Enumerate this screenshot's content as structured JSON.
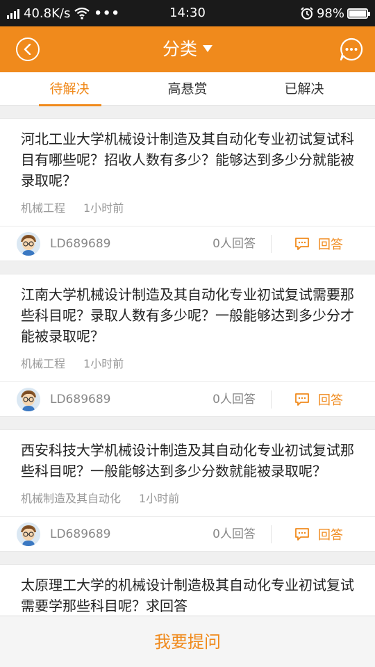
{
  "status_bar": {
    "speed": "40.8K/s",
    "dots": "•••",
    "time": "14:30",
    "battery": "98%",
    "battery_level": 0.98
  },
  "header": {
    "title": "分类"
  },
  "tabs": [
    {
      "label": "待解决"
    },
    {
      "label": "高悬赏"
    },
    {
      "label": "已解决"
    }
  ],
  "questions": [
    {
      "title": "河北工业大学机械设计制造及其自动化专业初试复试科目有哪些呢？招收人数有多少？能够达到多少分就能被录取呢？",
      "category": "机械工程",
      "time": "1小时前",
      "user": "LD689689",
      "answers": "0人回答",
      "answer_label": "回答"
    },
    {
      "title": "江南大学机械设计制造及其自动化专业初试复试需要那些科目呢？录取人数有多少呢？一般能够达到多少分才能被录取呢？",
      "category": "机械工程",
      "time": "1小时前",
      "user": "LD689689",
      "answers": "0人回答",
      "answer_label": "回答"
    },
    {
      "title": "西安科技大学机械设计制造及其自动化专业初试复试那些科目呢？一般能够达到多少分数就能被录取呢？",
      "category": "机械制造及其自动化",
      "time": "1小时前",
      "user": "LD689689",
      "answers": "0人回答",
      "answer_label": "回答"
    },
    {
      "title": "太原理工大学的机械设计制造极其自动化专业初试复试需要学那些科目呢？求回答",
      "category": "",
      "time": "",
      "user": "",
      "answers": "",
      "answer_label": ""
    }
  ],
  "bottom": {
    "ask_label": "我要提问"
  }
}
